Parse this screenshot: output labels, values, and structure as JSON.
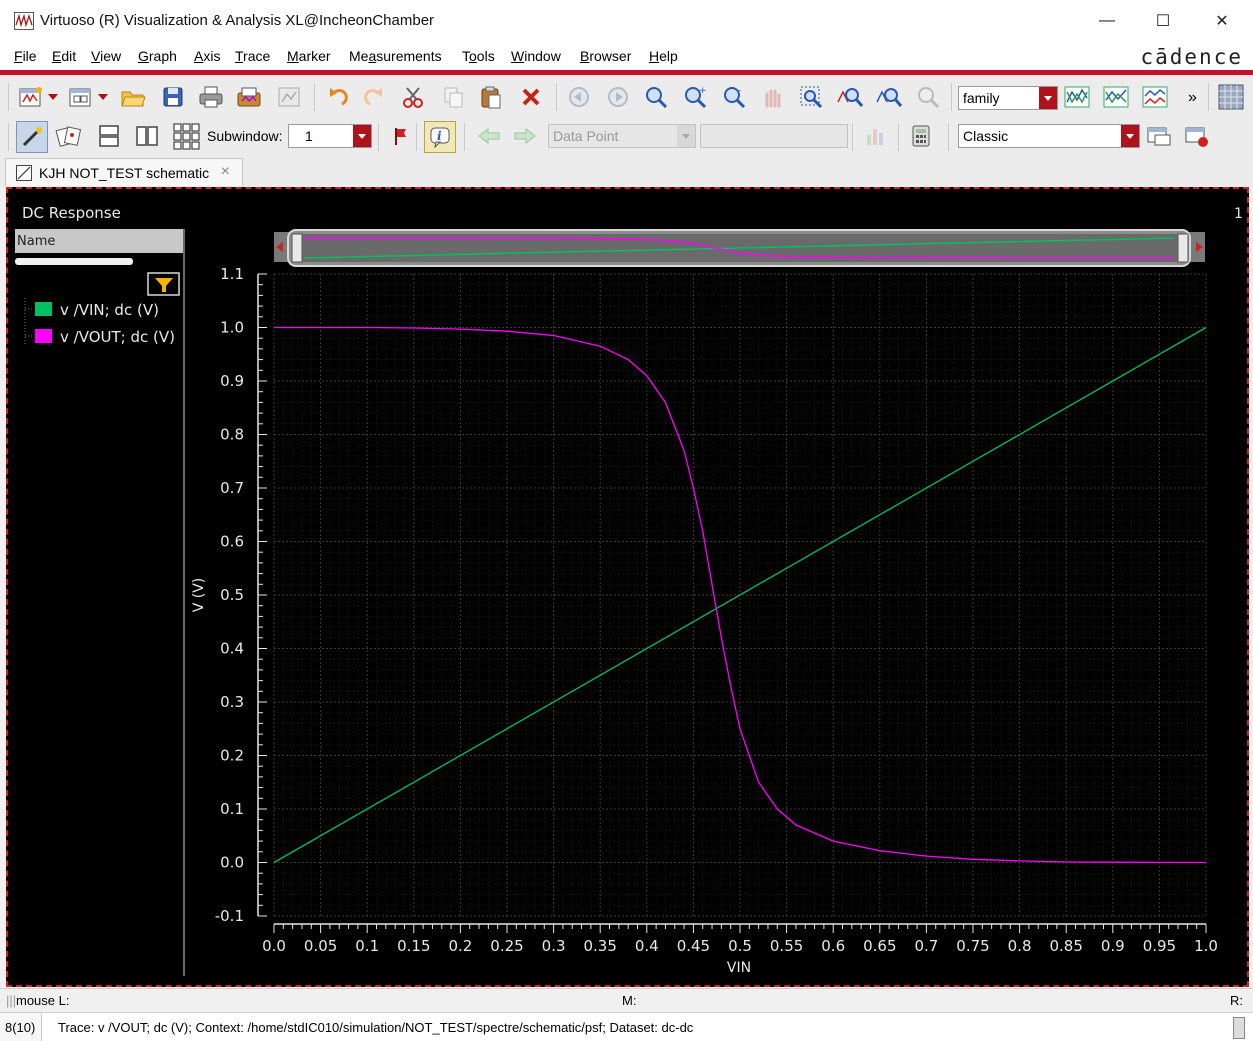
{
  "window": {
    "title": "Virtuoso (R) Visualization & Analysis XL@IncheonChamber",
    "minimize": "—",
    "maximize": "☐",
    "close": "✕"
  },
  "menu": [
    {
      "pre": "",
      "u": "F",
      "post": "ile"
    },
    {
      "pre": "",
      "u": "E",
      "post": "dit"
    },
    {
      "pre": "",
      "u": "V",
      "post": "iew"
    },
    {
      "pre": "",
      "u": "G",
      "post": "raph"
    },
    {
      "pre": "",
      "u": "A",
      "post": "xis"
    },
    {
      "pre": "",
      "u": "T",
      "post": "race"
    },
    {
      "pre": "",
      "u": "M",
      "post": "arker"
    },
    {
      "pre": "Me",
      "u": "a",
      "post": "surements"
    },
    {
      "pre": "T",
      "u": "o",
      "post": "ols"
    },
    {
      "pre": "",
      "u": "W",
      "post": "indow"
    },
    {
      "pre": "",
      "u": "B",
      "post": "rowser"
    },
    {
      "pre": "",
      "u": "H",
      "post": "elp"
    }
  ],
  "brand": "cādence",
  "toolbar": {
    "family_combo": "family",
    "more": "»",
    "subwindow_label": "Subwindow:",
    "subwindow_value": "1",
    "data_point_combo": "Data Point",
    "data_point_value": "",
    "style_combo": "Classic"
  },
  "tab": {
    "label": "KJH NOT_TEST schematic",
    "close": "×"
  },
  "legend": {
    "header": "Name",
    "filter_icon": "funnel",
    "items": [
      {
        "label": "v /VIN; dc (V)",
        "color": "#00c060"
      },
      {
        "label": "v /VOUT; dc (V)",
        "color": "#ff00ff"
      }
    ]
  },
  "subwindow_number": "1",
  "chart_data": {
    "type": "line",
    "title": "DC Response",
    "xlabel": "VIN",
    "ylabel": "V (V)",
    "xlim": [
      0.0,
      1.0
    ],
    "ylim": [
      -0.1,
      1.1
    ],
    "x_ticks": [
      "0.0",
      "0.05",
      "0.1",
      "0.15",
      "0.2",
      "0.25",
      "0.3",
      "0.35",
      "0.4",
      "0.45",
      "0.5",
      "0.55",
      "0.6",
      "0.65",
      "0.7",
      "0.75",
      "0.8",
      "0.85",
      "0.9",
      "0.95",
      "1.0"
    ],
    "y_ticks": [
      "-0.1",
      "0.0",
      "0.1",
      "0.2",
      "0.3",
      "0.4",
      "0.5",
      "0.6",
      "0.7",
      "0.8",
      "0.9",
      "1.0",
      "1.1"
    ],
    "background": "#000000",
    "grid": true,
    "series": [
      {
        "name": "v /VIN; dc (V)",
        "color": "#00c060",
        "x": [
          0.0,
          1.0
        ],
        "y": [
          0.0,
          1.0
        ]
      },
      {
        "name": "v /VOUT; dc (V)",
        "color": "#ff00ff",
        "x": [
          0.0,
          0.05,
          0.1,
          0.15,
          0.2,
          0.25,
          0.3,
          0.35,
          0.38,
          0.4,
          0.42,
          0.44,
          0.45,
          0.46,
          0.47,
          0.48,
          0.49,
          0.5,
          0.52,
          0.54,
          0.56,
          0.6,
          0.65,
          0.7,
          0.75,
          0.8,
          0.85,
          0.9,
          0.95,
          1.0
        ],
        "y": [
          1.0,
          1.0,
          1.0,
          0.999,
          0.997,
          0.993,
          0.985,
          0.965,
          0.94,
          0.91,
          0.86,
          0.77,
          0.7,
          0.62,
          0.52,
          0.42,
          0.33,
          0.25,
          0.15,
          0.1,
          0.07,
          0.04,
          0.022,
          0.012,
          0.006,
          0.003,
          0.001,
          0.0005,
          0.0002,
          0.0
        ]
      }
    ]
  },
  "status": {
    "mouse_l": "mouse L:",
    "mouse_m": "M:",
    "mouse_r": "R:",
    "count": "8(10)",
    "message": "Trace: v /VOUT; dc (V); Context: /home/stdIC010/simulation/NOT_TEST/spectre/schematic/psf; Dataset: dc-dc"
  }
}
